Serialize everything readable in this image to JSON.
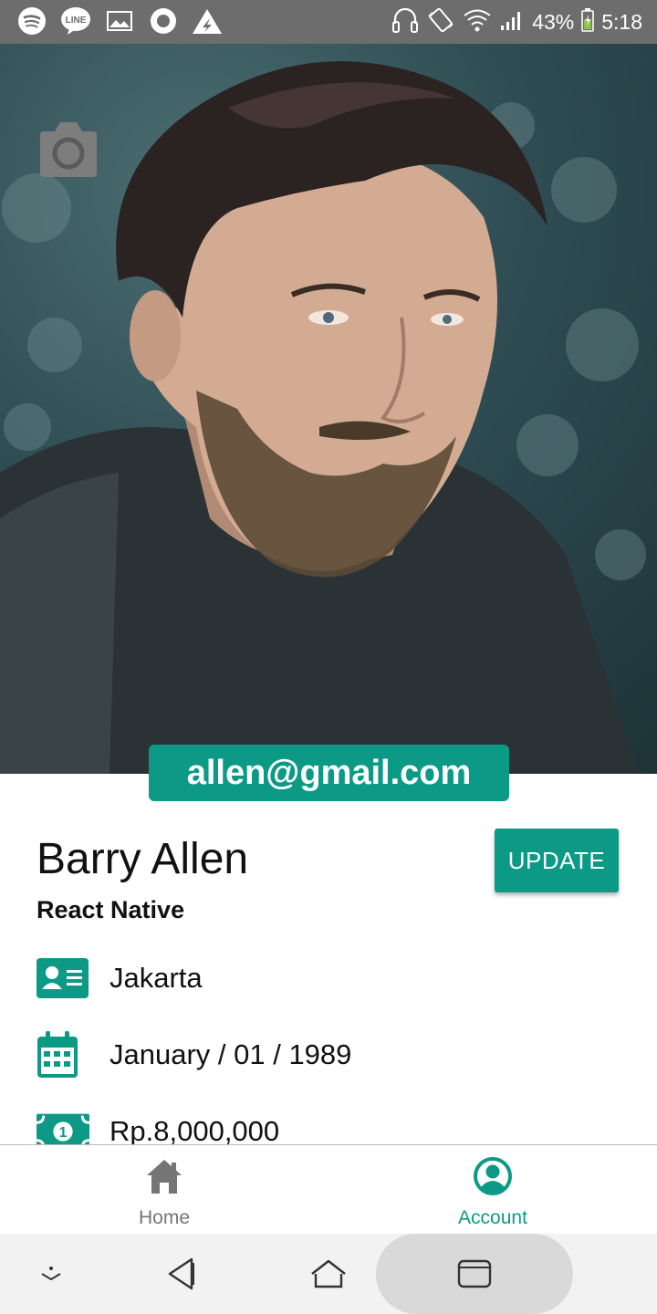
{
  "status_bar": {
    "battery": "43%",
    "time": "5:18",
    "icons": [
      "spotify-icon",
      "line-icon",
      "gallery-icon",
      "record-icon",
      "airdroid-icon",
      "headphones-icon",
      "vibrate-icon",
      "wifi-icon",
      "signal-icon",
      "battery-icon"
    ],
    "line_text": "LINE"
  },
  "profile": {
    "email": "allen@gmail.com",
    "name": "Barry Allen",
    "role": "React Native",
    "update_label": "UPDATE",
    "details": [
      {
        "icon": "id-card-icon",
        "text": "Jakarta"
      },
      {
        "icon": "calendar-icon",
        "text": "January / 01 / 1989"
      },
      {
        "icon": "money-icon",
        "text": "Rp.8,000,000"
      }
    ]
  },
  "tabs": [
    {
      "label": "Home",
      "icon": "home-icon",
      "active": false
    },
    {
      "label": "Account",
      "icon": "account-icon",
      "active": true
    }
  ],
  "colors": {
    "accent": "#0c9a86",
    "inactive_tab": "#757575",
    "status_bar": "#6d6d6d"
  }
}
